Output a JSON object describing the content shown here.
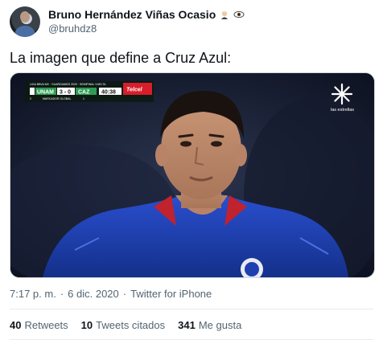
{
  "author": {
    "display_name": "Bruno Hernández Viñas Ocasio",
    "handle": "@bruhdz8",
    "badges": [
      "man-judge-emoji",
      "eye-emoji"
    ]
  },
  "tweet": {
    "text": "La imagen que define a Cruz Azul:"
  },
  "media": {
    "scoreboard": {
      "league": "LIGA BBVA MX · GUARDIANES 2020 · SEMIFINAL VUELTA",
      "home": "UNAM",
      "score": "3 - 0",
      "away": "CAZ",
      "clock": "40:38",
      "global_label": "MARCADOR GLOBAL",
      "global_home": "2",
      "global_away": "1",
      "sponsor": "Telcel"
    },
    "channel": "las estrellas"
  },
  "meta": {
    "time": "7:17 p. m.",
    "separator": "·",
    "date": "6 dic. 2020",
    "source": "Twitter for iPhone"
  },
  "stats": {
    "retweets_count": "40",
    "retweets_label": "Retweets",
    "quotes_count": "10",
    "quotes_label": "Tweets citados",
    "likes_count": "341",
    "likes_label": "Me gusta"
  },
  "colors": {
    "text_primary": "#0f1419",
    "text_secondary": "#536471",
    "jersey_blue": "#1f3fb0",
    "divider": "#e6ecf0"
  }
}
